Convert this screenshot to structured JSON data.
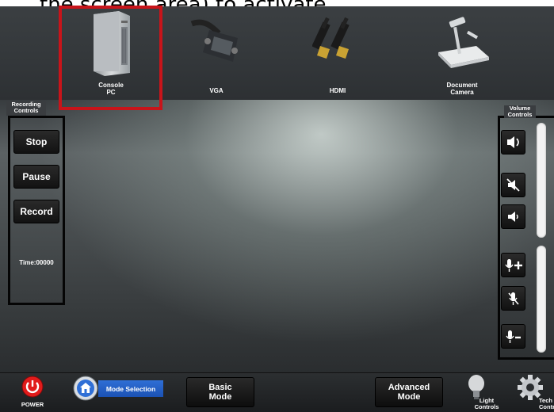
{
  "caption": "the screen area) to activate",
  "sources": [
    {
      "label": "Console\nPC",
      "icon": "desktop-tower-icon",
      "selected": true
    },
    {
      "label": "VGA",
      "icon": "vga-cable-icon",
      "selected": false
    },
    {
      "label": "HDMI",
      "icon": "hdmi-cable-icon",
      "selected": false
    },
    {
      "label": "Document\nCamera",
      "icon": "document-camera-icon",
      "selected": false
    }
  ],
  "recording": {
    "title": "Recording\nControls",
    "stop": "Stop",
    "pause": "Pause",
    "record": "Record",
    "time": "Time:00000"
  },
  "volume": {
    "title": "Volume\nControls",
    "buttons": [
      "volume-up-icon",
      "mute-icon",
      "volume-down-icon",
      "mic-up-icon",
      "mic-mute-icon",
      "mic-down-icon"
    ]
  },
  "footer": {
    "power": "POWER",
    "mode_selection": "Mode Selection",
    "basic_mode": "Basic\nMode",
    "advanced_mode": "Advanced\nMode",
    "light_controls": "Light\nControls",
    "tech_controls": "Tech\nControls"
  },
  "colors": {
    "selection": "#c8141a",
    "mode_selection_bg": "#2f6fd6",
    "power_red": "#e11b1b"
  }
}
